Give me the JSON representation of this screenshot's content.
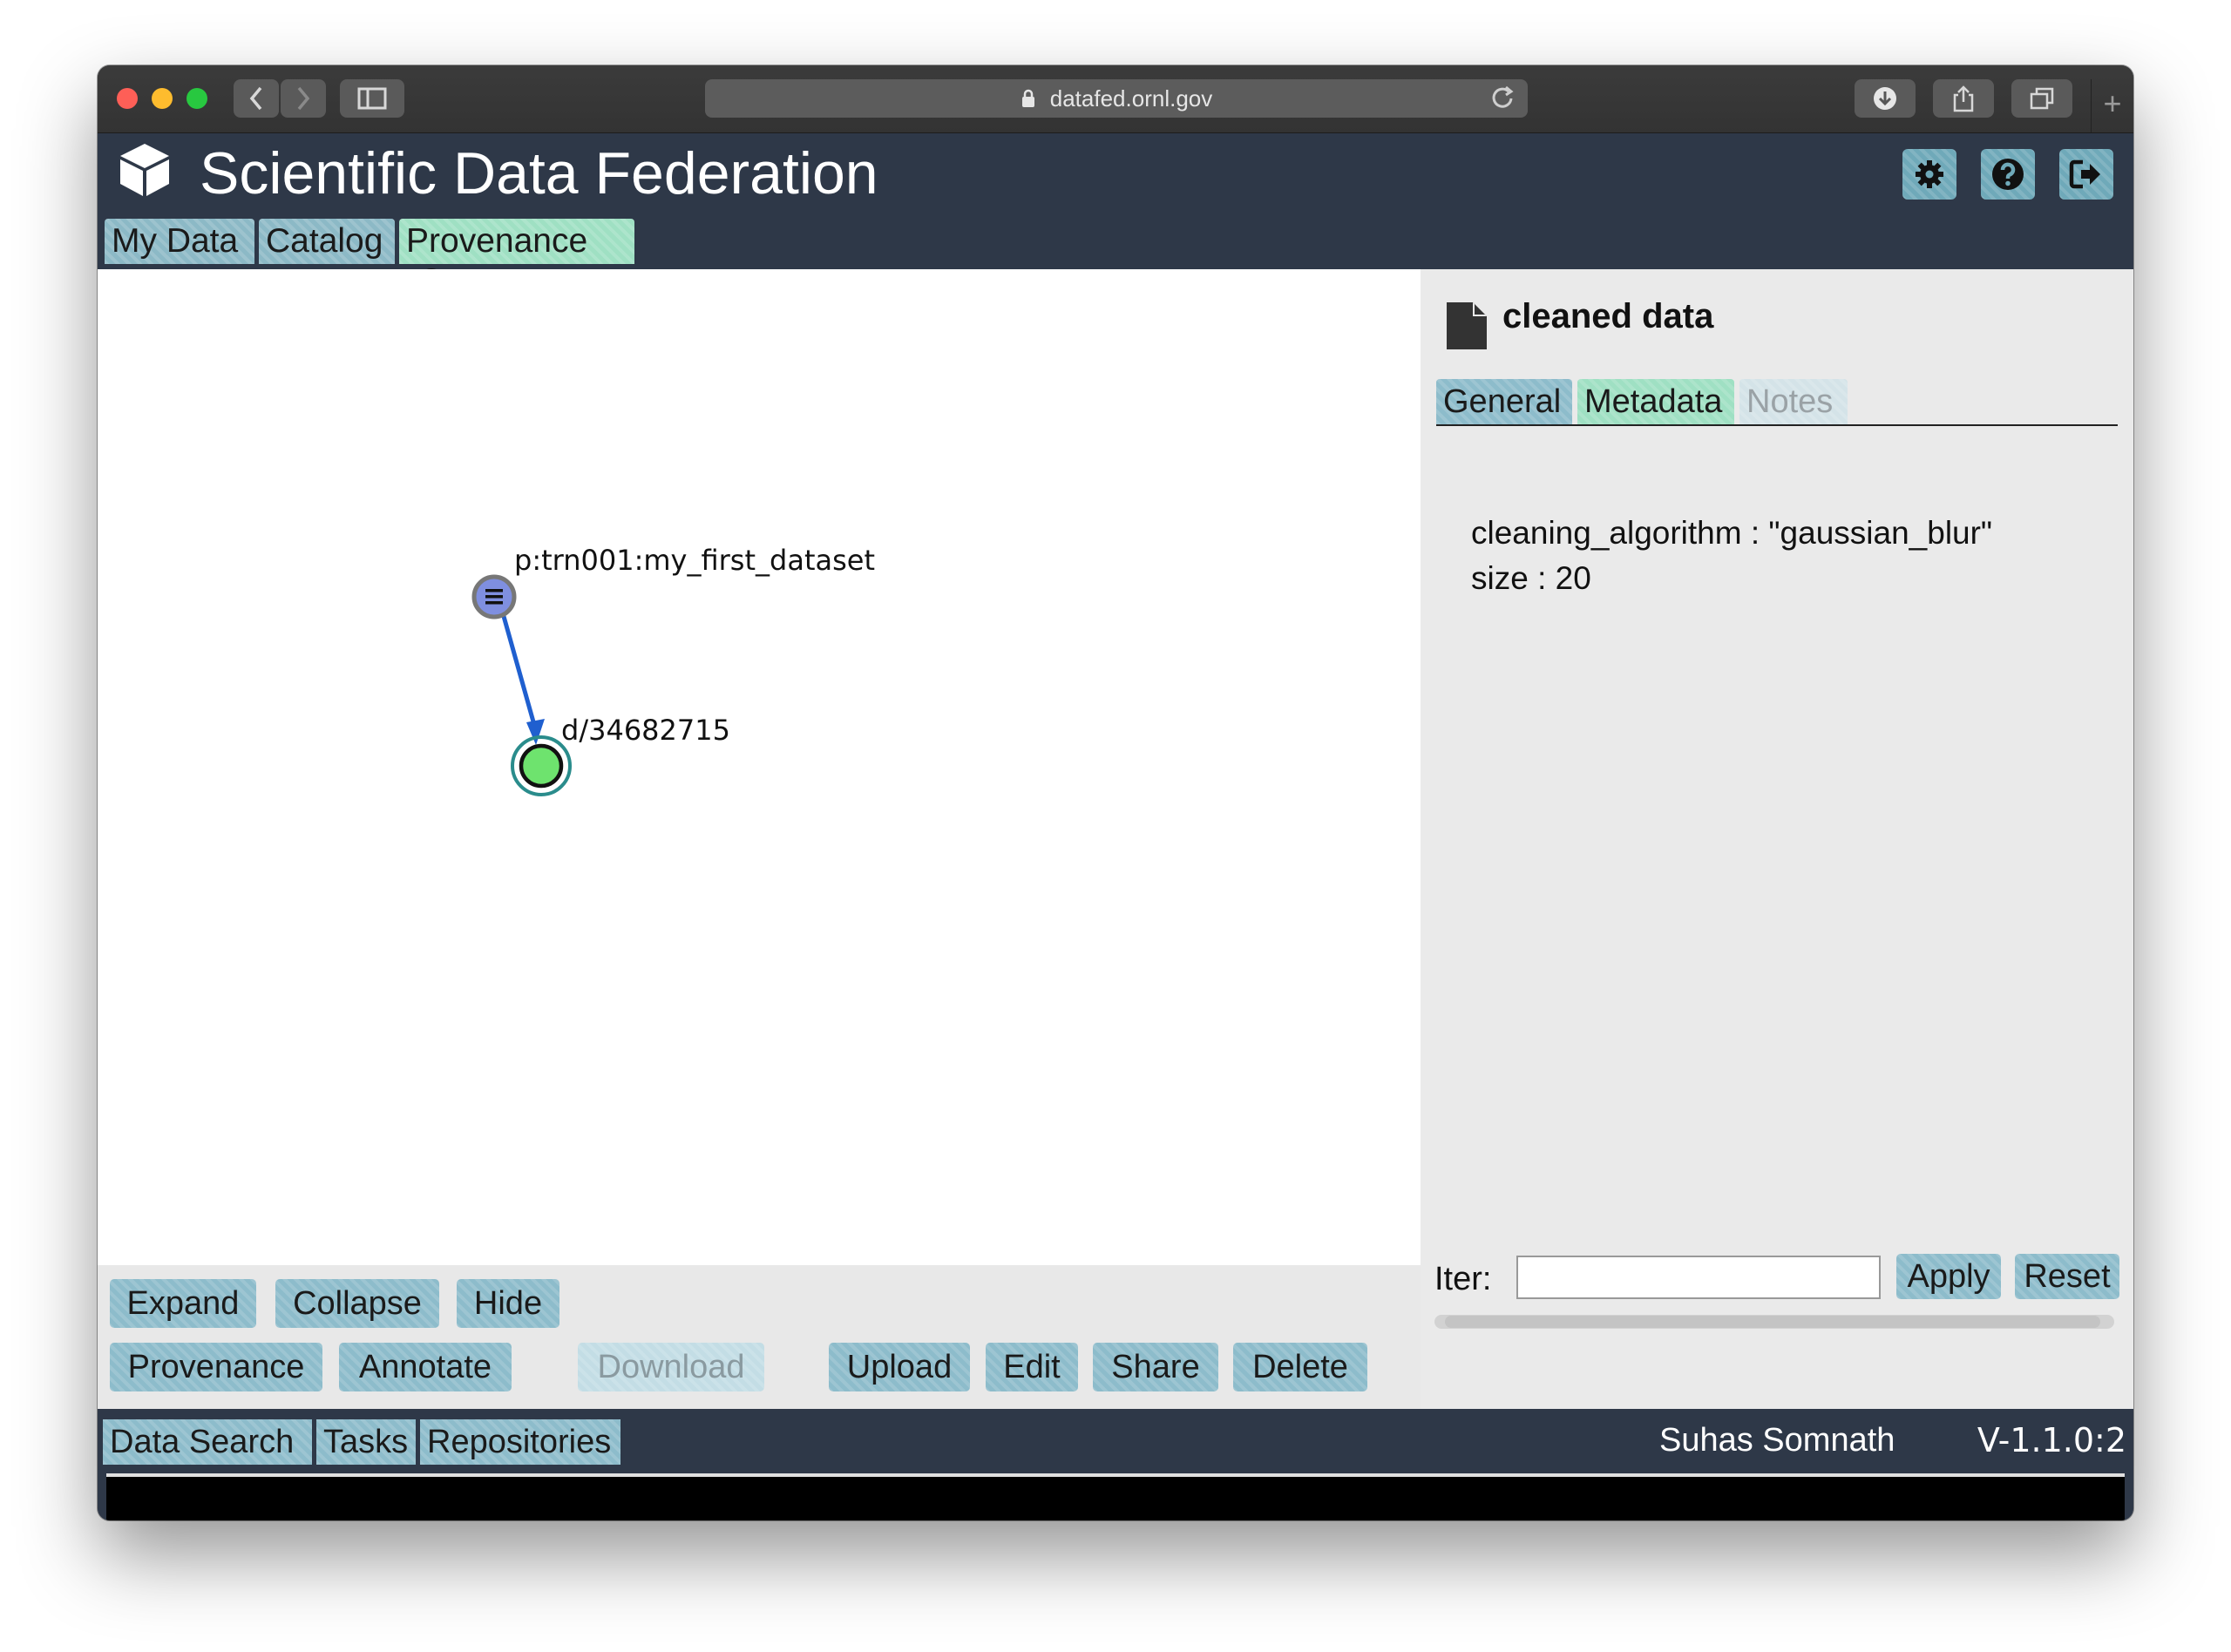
{
  "browser": {
    "url": "datafed.ornl.gov",
    "icons": {
      "back": "chevron-left-icon",
      "forward": "chevron-right-icon",
      "sidebar": "sidebar-icon",
      "reload": "reload-icon",
      "download": "download-icon",
      "share": "share-icon",
      "tabs": "tabs-icon",
      "new_tab": "plus-icon"
    }
  },
  "app": {
    "title": "Scientific Data Federation",
    "logo_icon": "cube-icon",
    "header_buttons": [
      {
        "name": "settings",
        "icon": "gear-icon"
      },
      {
        "name": "help",
        "icon": "question-icon"
      },
      {
        "name": "logout",
        "icon": "logout-icon"
      }
    ],
    "tabs": [
      {
        "label": "My Data",
        "active": false
      },
      {
        "label": "Catalog",
        "active": false
      },
      {
        "label": "Provenance",
        "active": true,
        "closable": true
      }
    ]
  },
  "graph": {
    "nodes": [
      {
        "id": "p:trn001:my_first_dataset",
        "label": "p:trn001:my_first_dataset",
        "kind": "collection",
        "color": "#7f8fe0"
      },
      {
        "id": "d/34682715",
        "label": "d/34682715",
        "kind": "record",
        "selected": true,
        "color": "#6ee36e"
      }
    ],
    "edges": [
      {
        "from": "p:trn001:my_first_dataset",
        "to": "d/34682715",
        "color": "#1f5fcf"
      }
    ]
  },
  "toolbar": {
    "row1": [
      "Expand",
      "Collapse",
      "Hide"
    ],
    "row2": [
      "Provenance",
      "Annotate",
      "Download",
      "Upload",
      "Edit",
      "Share",
      "Delete"
    ],
    "disabled": [
      "Download"
    ]
  },
  "info": {
    "title": "cleaned data",
    "title_icon": "document-icon",
    "tabs": [
      {
        "label": "General",
        "state": "normal"
      },
      {
        "label": "Metadata",
        "state": "active"
      },
      {
        "label": "Notes",
        "state": "disabled"
      }
    ],
    "metadata": [
      "cleaning_algorithm : \"gaussian_blur\"",
      "size : 20"
    ],
    "iter_label": "Iter:",
    "iter_value": "",
    "apply_label": "Apply",
    "reset_label": "Reset"
  },
  "footer": {
    "tabs": [
      "Data Search",
      "Tasks",
      "Repositories"
    ],
    "user": "Suhas Somnath",
    "version": "V-1.1.0:2"
  },
  "colors": {
    "header_bg": "#2e3848",
    "tab_bg": "#8dbccb",
    "tab_active_bg": "#9fe0c3",
    "info_bg": "#eaeaea"
  }
}
